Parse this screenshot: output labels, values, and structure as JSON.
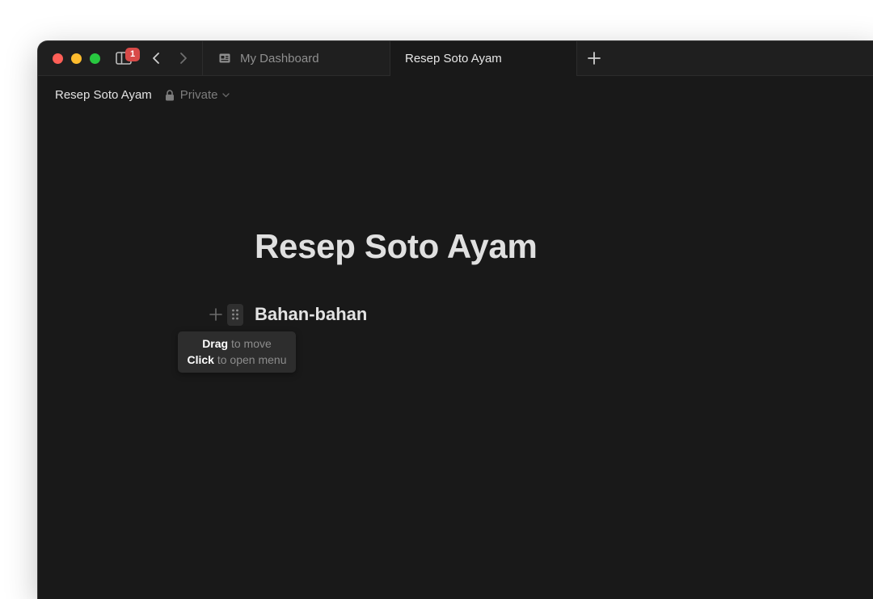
{
  "window": {
    "traffic_lights": [
      "close",
      "minimize",
      "zoom"
    ],
    "sidebar_badge": "1"
  },
  "tabs": [
    {
      "label": "My Dashboard",
      "active": false,
      "icon": "dashboard-card-icon"
    },
    {
      "label": "Resep Soto Ayam",
      "active": true
    }
  ],
  "breadcrumb": {
    "page_title": "Resep Soto Ayam",
    "privacy": "Private"
  },
  "page": {
    "title": "Resep Soto Ayam",
    "blocks": [
      {
        "type": "heading",
        "text": "Bahan-bahan"
      }
    ]
  },
  "tooltip": {
    "line1_strong": "Drag",
    "line1_rest": " to move",
    "line2_strong": "Click",
    "line2_rest": " to open menu"
  },
  "colors": {
    "background": "#191919",
    "titlebar": "#1f1f1f",
    "badge": "#d84a48",
    "text": "#e3e3e3",
    "muted": "#7d7d7d"
  }
}
